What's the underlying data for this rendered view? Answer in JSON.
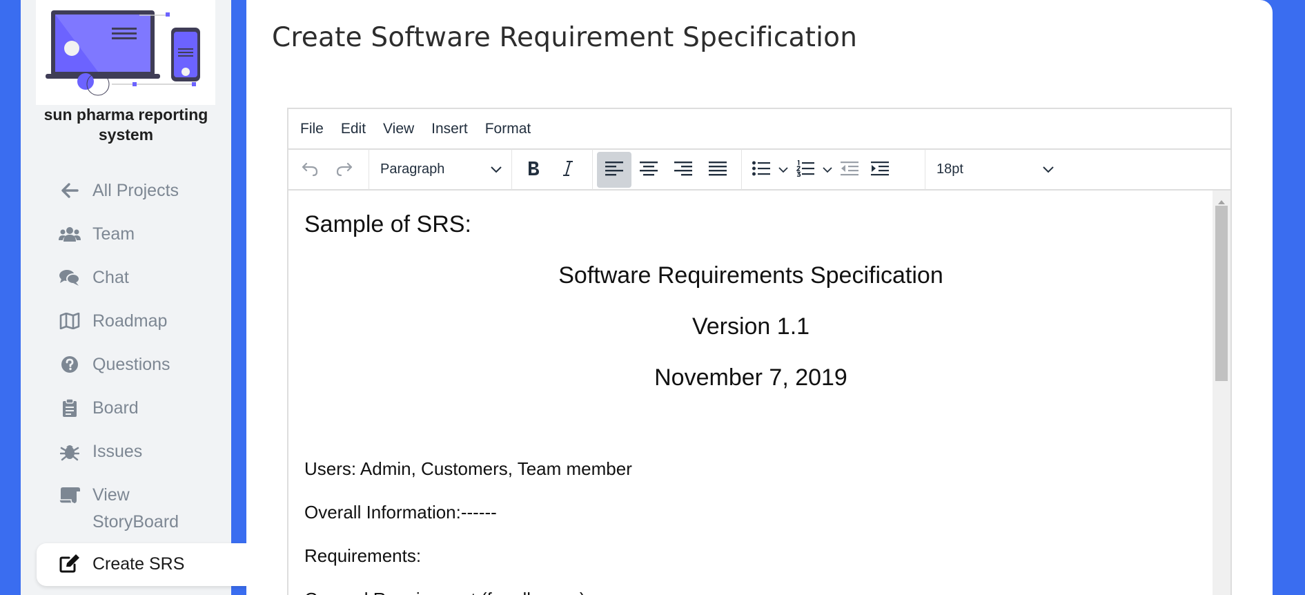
{
  "sidebar": {
    "brand": "sun pharma reporting system",
    "items": [
      {
        "label": "All Projects",
        "icon": "arrow-left-icon"
      },
      {
        "label": "Team",
        "icon": "users-icon"
      },
      {
        "label": "Chat",
        "icon": "comments-icon"
      },
      {
        "label": "Roadmap",
        "icon": "map-icon"
      },
      {
        "label": "Questions",
        "icon": "question-circle-icon"
      },
      {
        "label": "Board",
        "icon": "clipboard-icon"
      },
      {
        "label": "Issues",
        "icon": "bug-icon"
      },
      {
        "label": "View StoryBoard",
        "line1": "View",
        "line2": "StoryBoard",
        "icon": "scroll-icon"
      },
      {
        "label": "Create SRS",
        "icon": "edit-icon",
        "active": true
      }
    ]
  },
  "main": {
    "title": "Create Software Requirement Specification"
  },
  "editor": {
    "menu": [
      "File",
      "Edit",
      "View",
      "Insert",
      "Format"
    ],
    "block_format": "Paragraph",
    "font_size": "18pt",
    "content": {
      "heading": "Sample of SRS:",
      "doc_title": "Software Requirements Specification",
      "version": "Version 1.1",
      "date": "November 7, 2019",
      "users": "Users: Admin, Customers, Team member",
      "overall": "Overall Information:------",
      "requirements": "Requirements:",
      "general": "General Requirement (for all users)"
    }
  },
  "colors": {
    "background": "#3a6df0",
    "sidebar_bg": "#f1f3f5",
    "nav_text": "#7d8793",
    "active_button_bg": "#cfd3d8"
  }
}
